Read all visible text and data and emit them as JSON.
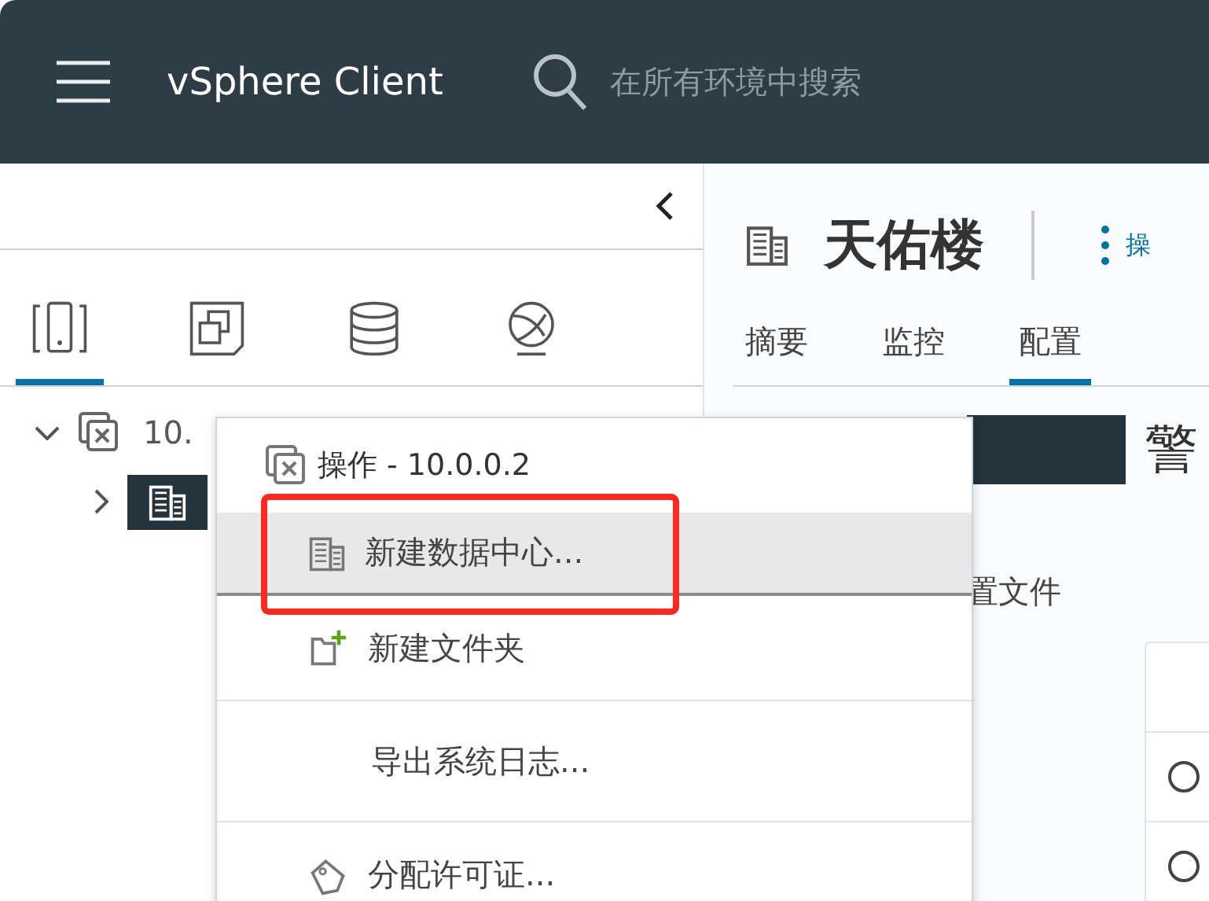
{
  "top_bar": {
    "title": "vSphere Client",
    "search": {
      "placeholder": "在所有环境中搜索"
    }
  },
  "navigator": {
    "view_tabs": [
      {
        "kind": "hosts",
        "selected": true
      },
      {
        "kind": "vms",
        "selected": false
      },
      {
        "kind": "storage",
        "selected": false
      },
      {
        "kind": "network",
        "selected": false
      }
    ],
    "tree": [
      {
        "kind": "vcenter",
        "label": "10.",
        "expanded": true,
        "selected": false,
        "children": [
          {
            "kind": "datacenter",
            "expanded": false,
            "selected": true
          }
        ]
      }
    ]
  },
  "header": {
    "title": "天佑楼",
    "actions_label": "操",
    "tabs": [
      {
        "label": "摘要",
        "selected": false
      },
      {
        "label": "监控",
        "selected": false
      },
      {
        "label": "配置",
        "selected": true
      }
    ]
  },
  "content": {
    "section_title": "警",
    "subtitle": "置文件",
    "list_rows": [
      {
        "selected": false
      },
      {
        "selected": false
      }
    ]
  },
  "context_menu": {
    "title": "操作 - 10.0.0.2",
    "items": [
      {
        "kind": "datacenter",
        "label": "新建数据中心...",
        "highlighted": true,
        "framed": true,
        "separator_before": false
      },
      {
        "kind": "new-folder",
        "label": "新建文件夹",
        "highlighted": false,
        "framed": false,
        "separator_before": false
      },
      {
        "kind": "plain",
        "label": "导出系统日志...",
        "highlighted": false,
        "framed": false,
        "separator_before": true
      },
      {
        "kind": "license",
        "label": "分配许可证...",
        "highlighted": false,
        "framed": false,
        "separator_before": true
      }
    ]
  }
}
